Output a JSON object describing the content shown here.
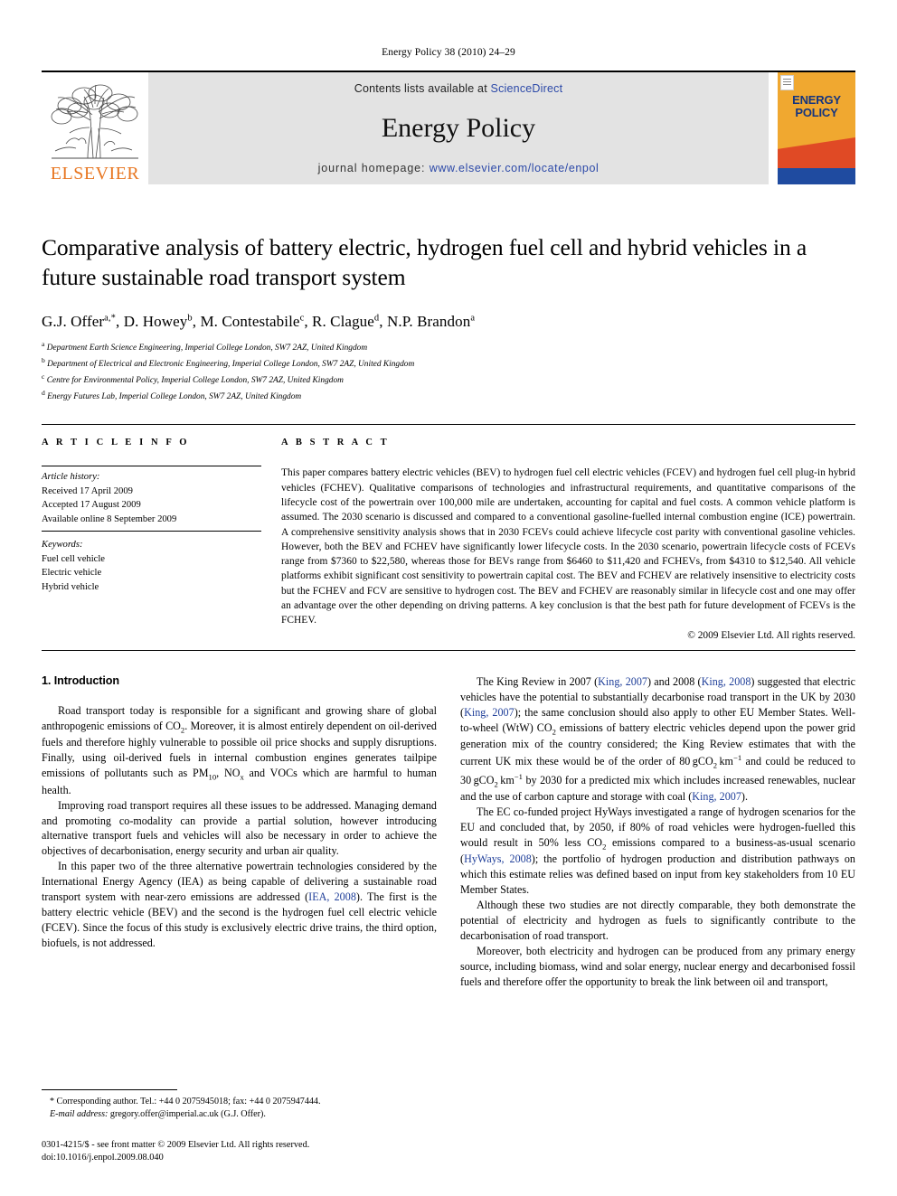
{
  "running_head": "Energy Policy 38 (2010) 24–29",
  "masthead": {
    "publisher_name": "ELSEVIER",
    "contents_prefix": "Contents lists available at ",
    "contents_link": "ScienceDirect",
    "journal_title": "Energy Policy",
    "homepage_prefix": "journal homepage: ",
    "homepage_url": "www.elsevier.com/locate/enpol",
    "cover_title_line1": "ENERGY",
    "cover_title_line2": "POLICY",
    "colors": {
      "elsevier_orange": "#E87722",
      "link_blue": "#2c49a8",
      "cover_amber": "#f0a830",
      "cover_red": "#e04a25",
      "cover_blue": "#1f4ba0",
      "cover_text_blue": "#15357f",
      "band_gray": "#e3e3e3"
    }
  },
  "article": {
    "title": "Comparative analysis of battery electric, hydrogen fuel cell and hybrid vehicles in a future sustainable road transport system",
    "authors_html": "G.J. Offer<sup>a,*</sup>, D. Howey<sup>b</sup>, M. Contestabile<sup>c</sup>, R. Clague<sup>d</sup>, N.P. Brandon<sup>a</sup>",
    "affiliations": [
      {
        "mark": "a",
        "text": "Department Earth Science Engineering, Imperial College London, SW7 2AZ, United Kingdom"
      },
      {
        "mark": "b",
        "text": "Department of Electrical and Electronic Engineering, Imperial College London, SW7 2AZ, United Kingdom"
      },
      {
        "mark": "c",
        "text": "Centre for Environmental Policy, Imperial College London, SW7 2AZ, United Kingdom"
      },
      {
        "mark": "d",
        "text": "Energy Futures Lab, Imperial College London, SW7 2AZ, United Kingdom"
      }
    ]
  },
  "article_info": {
    "heading": "A R T I C L E   I N F O",
    "history_label": "Article history:",
    "history": [
      "Received 17 April 2009",
      "Accepted 17 August 2009",
      "Available online 8 September 2009"
    ],
    "keywords_label": "Keywords:",
    "keywords": [
      "Fuel cell vehicle",
      "Electric vehicle",
      "Hybrid vehicle"
    ]
  },
  "abstract": {
    "heading": "A B S T R A C T",
    "text": "This paper compares battery electric vehicles (BEV) to hydrogen fuel cell electric vehicles (FCEV) and hydrogen fuel cell plug-in hybrid vehicles (FCHEV). Qualitative comparisons of technologies and infrastructural requirements, and quantitative comparisons of the lifecycle cost of the powertrain over 100,000 mile are undertaken, accounting for capital and fuel costs. A common vehicle platform is assumed. The 2030 scenario is discussed and compared to a conventional gasoline-fuelled internal combustion engine (ICE) powertrain. A comprehensive sensitivity analysis shows that in 2030 FCEVs could achieve lifecycle cost parity with conventional gasoline vehicles. However, both the BEV and FCHEV have significantly lower lifecycle costs. In the 2030 scenario, powertrain lifecycle costs of FCEVs range from $7360 to $22,580, whereas those for BEVs range from $6460 to $11,420 and FCHEVs, from $4310 to $12,540. All vehicle platforms exhibit significant cost sensitivity to powertrain capital cost. The BEV and FCHEV are relatively insensitive to electricity costs but the FCHEV and FCV are sensitive to hydrogen cost. The BEV and FCHEV are reasonably similar in lifecycle cost and one may offer an advantage over the other depending on driving patterns. A key conclusion is that the best path for future development of FCEVs is the FCHEV.",
    "copyright": "© 2009 Elsevier Ltd. All rights reserved."
  },
  "body": {
    "section_title": "1.  Introduction",
    "left_paragraphs_html": [
      "Road transport today is responsible for a significant and growing share of global anthropogenic emissions of CO<sub>2</sub>. Moreover, it is almost entirely dependent on oil-derived fuels and therefore highly vulnerable to possible oil price shocks and supply disruptions. Finally, using oil-derived fuels in internal combustion engines generates tailpipe emissions of pollutants such as PM<sub>10</sub>, NO<sub>x</sub> and VOCs which are harmful to human health.",
      "Improving road transport requires all these issues to be addressed. Managing demand and promoting co-modality can provide a partial solution, however introducing alternative transport fuels and vehicles will also be necessary in order to achieve the objectives of decarbonisation, energy security and urban air quality.",
      "In this paper two of the three alternative powertrain technologies considered by the International Energy Agency (IEA) as being capable of delivering a sustainable road transport system with near-zero emissions are addressed (<span class=\"cite\">IEA, 2008</span>). The first is the battery electric vehicle (BEV) and the second is the hydrogen fuel cell electric vehicle (FCEV). Since the focus of this study is exclusively electric drive trains, the third option, biofuels, is not addressed."
    ],
    "right_paragraphs_html": [
      "The King Review in 2007 (<span class=\"cite\">King, 2007</span>) and 2008 (<span class=\"cite\">King, 2008</span>) suggested that electric vehicles have the potential to substantially decarbonise road transport in the UK by 2030 (<span class=\"cite\">King, 2007</span>); the same conclusion should also apply to other EU Member States. Well-to-wheel (WtW) CO<sub>2</sub> emissions of battery electric vehicles depend upon the power grid generation mix of the country considered; the King Review estimates that with the current UK mix these would be of the order of 80&#8239;gCO<sub>2</sub>&#8239;km<sup>&#8722;1</sup> and could be reduced to 30&#8239;gCO<sub>2</sub>&#8239;km<sup>&#8722;1</sup> by 2030 for a predicted mix which includes increased renewables, nuclear and the use of carbon capture and storage with coal (<span class=\"cite\">King, 2007</span>).",
      "The EC co-funded project HyWays investigated a range of hydrogen scenarios for the EU and concluded that, by 2050, if 80% of road vehicles were hydrogen-fuelled this would result in 50% less CO<sub>2</sub> emissions compared to a business-as-usual scenario (<span class=\"cite\">HyWays, 2008</span>); the portfolio of hydrogen production and distribution pathways on which this estimate relies was defined based on input from key stakeholders from 10 EU Member States.",
      "Although these two studies are not directly comparable, they both demonstrate the potential of electricity and hydrogen as fuels to significantly contribute to the decarbonisation of road transport.",
      "Moreover, both electricity and hydrogen can be produced from any primary energy source, including biomass, wind and solar energy, nuclear energy and decarbonised fossil fuels and therefore offer the opportunity to break the link between oil and transport,"
    ]
  },
  "footer": {
    "corresponding_html": "<span class=\"star\">*</span> Corresponding author. Tel.: +44 0 2075945018; fax: +44 0 2075947444.",
    "email_html": "<span class=\"em\">E-mail address:</span> gregory.offer@imperial.ac.uk (G.J. Offer).",
    "front_matter_line1": "0301-4215/$ - see front matter © 2009 Elsevier Ltd. All rights reserved.",
    "front_matter_line2": "doi:10.1016/j.enpol.2009.08.040"
  }
}
